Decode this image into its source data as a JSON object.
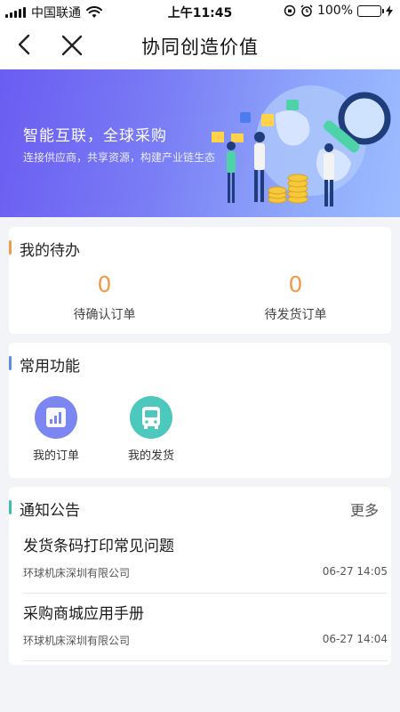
{
  "status_bar": {
    "carrier": "中国联通",
    "time": "上午11:45",
    "battery": "100%"
  },
  "nav": {
    "title": "协同创造价值"
  },
  "banner": {
    "title": "智能互联，全球采购",
    "subtitle": "连接供应商，共享资源，构建产业链生态"
  },
  "todo": {
    "title": "我的待办",
    "accent": "#f19a4a",
    "items": [
      {
        "count": "0",
        "label": "待确认订单"
      },
      {
        "count": "0",
        "label": "待发货订单"
      }
    ]
  },
  "functions": {
    "title": "常用功能",
    "accent": "#5b8be6",
    "items": [
      {
        "label": "我的订单",
        "icon": "order-chart-icon",
        "color": "#7b86f0"
      },
      {
        "label": "我的发货",
        "icon": "delivery-bus-icon",
        "color": "#4cc8bd"
      }
    ]
  },
  "notices": {
    "title": "通知公告",
    "more": "更多",
    "accent": "#3fbfb2",
    "items": [
      {
        "title": "发货条码打印常见问题",
        "company": "环球机床深圳有限公司",
        "date": "06-27 14:05"
      },
      {
        "title": "采购商城应用手册",
        "company": "环球机床深圳有限公司",
        "date": "06-27 14:04"
      }
    ]
  }
}
